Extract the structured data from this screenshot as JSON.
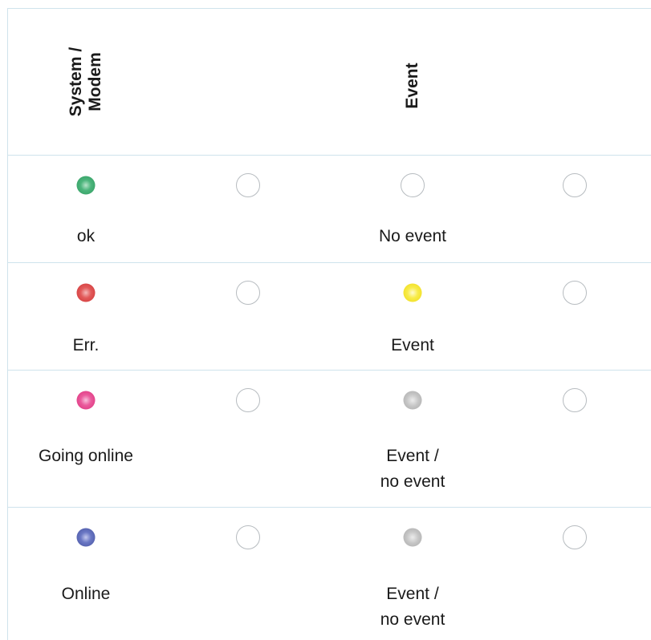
{
  "header": {
    "system_modem": "System /\nModem",
    "event": "Event"
  },
  "rows": [
    {
      "system_led_color": "#2e9a5e",
      "system_label": "ok",
      "event_led_color": null,
      "event_label": "No event"
    },
    {
      "system_led_color": "#d8393a",
      "system_label": "Err.",
      "event_led_color": "#f2e21c",
      "event_label": "Event"
    },
    {
      "system_led_color": "#e0337e",
      "system_label": "Going online",
      "event_led_color": "#b8b8b8",
      "event_label": "Event /\nno event"
    },
    {
      "system_led_color": "#4a59a8",
      "system_label": "Online",
      "event_led_color": "#b8b8b8",
      "event_label": "Event /\nno event"
    }
  ]
}
